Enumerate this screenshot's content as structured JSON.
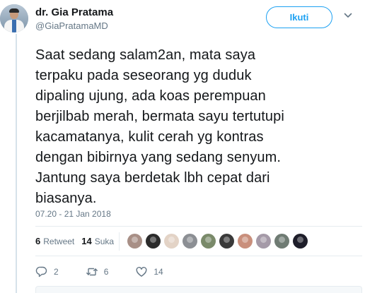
{
  "author": {
    "name": "dr. Gia Pratama",
    "handle": "@GiaPratamaMD"
  },
  "follow_button": {
    "label": "Ikuti"
  },
  "tweet": {
    "text": "Saat sedang salam2an, mata saya\nterpaku pada seseorang yg duduk\ndipaling ujung, ada koas perempuan\nberjilbab merah, bermata sayu tertutupi\nkacamatanya, kulit cerah yg kontras\ndengan bibirnya yang sedang senyum.\nJantung saya berdetak lbh cepat dari\nbiasanya.",
    "timestamp": "07.20 - 21 Jan 2018"
  },
  "stats": {
    "retweets": {
      "count": "6",
      "label": "Retweet"
    },
    "likes": {
      "count": "14",
      "label": "Suka"
    }
  },
  "likers": [
    {
      "icon": "liker-avatar",
      "color": "#a88f86"
    },
    {
      "icon": "liker-avatar",
      "color": "#2b2b2b"
    },
    {
      "icon": "liker-avatar",
      "color": "#e3d3c6"
    },
    {
      "icon": "liker-avatar",
      "color": "#8c8f94"
    },
    {
      "icon": "liker-avatar",
      "color": "#7a8a6a"
    },
    {
      "icon": "liker-avatar",
      "color": "#3a3a3a"
    },
    {
      "icon": "liker-avatar",
      "color": "#c98f7c"
    },
    {
      "icon": "liker-avatar",
      "color": "#a59aa8"
    },
    {
      "icon": "liker-avatar",
      "color": "#6f7b73"
    },
    {
      "icon": "liker-avatar",
      "color": "#1e1e2a"
    }
  ],
  "actions": {
    "reply": {
      "count": "2",
      "icon": "reply-icon"
    },
    "retweet": {
      "count": "6",
      "icon": "retweet-icon"
    },
    "like": {
      "count": "14",
      "icon": "heart-icon"
    }
  },
  "colors": {
    "accent": "#1da1f2",
    "muted": "#657786",
    "text": "#14171a"
  }
}
